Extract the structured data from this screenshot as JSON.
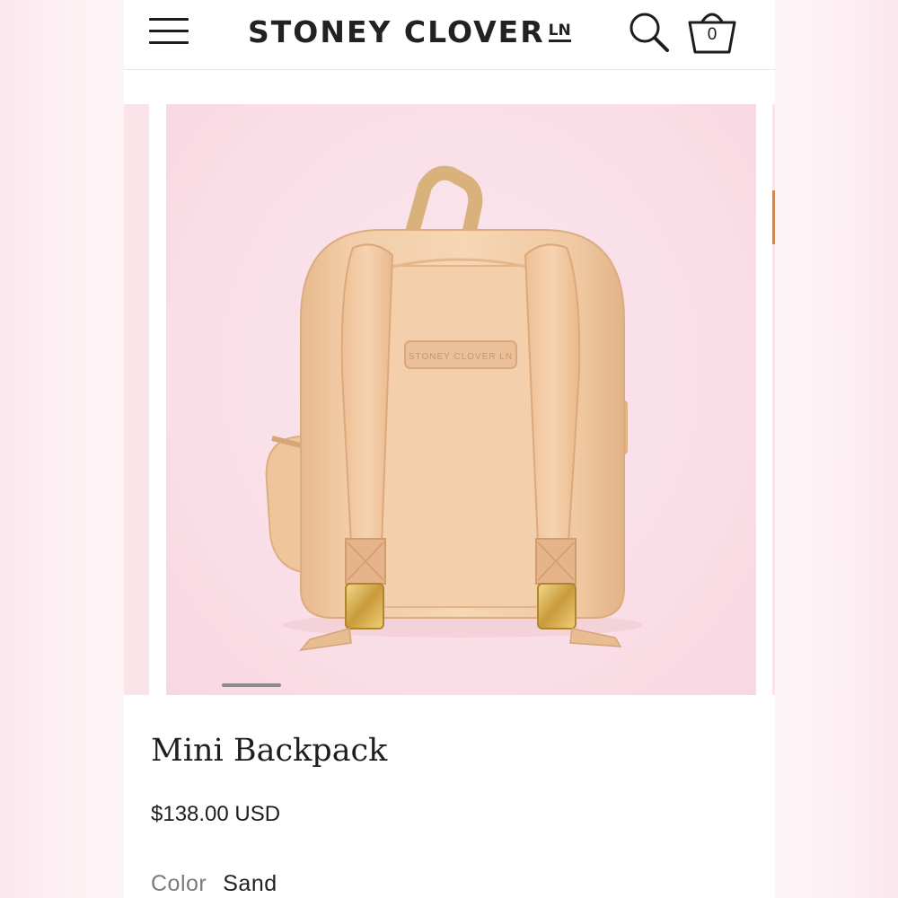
{
  "header": {
    "brand": "STONEY CLOVER",
    "brand_suffix": "LN",
    "cart_count": "0",
    "icons": [
      "hamburger-menu-icon",
      "search-icon",
      "shopping-basket-icon"
    ]
  },
  "gallery": {
    "image_subject": "backpack",
    "patch_text": "STONEY CLOVER LN",
    "active_slide_indicator": 1
  },
  "product": {
    "title": "Mini Backpack",
    "price": "$138.00 USD",
    "color_label": "Color",
    "color_value": "Sand"
  },
  "colors": {
    "product_fill": "#f1cba4",
    "background_pink": "#fadde6",
    "text": "#1e1e1e"
  }
}
